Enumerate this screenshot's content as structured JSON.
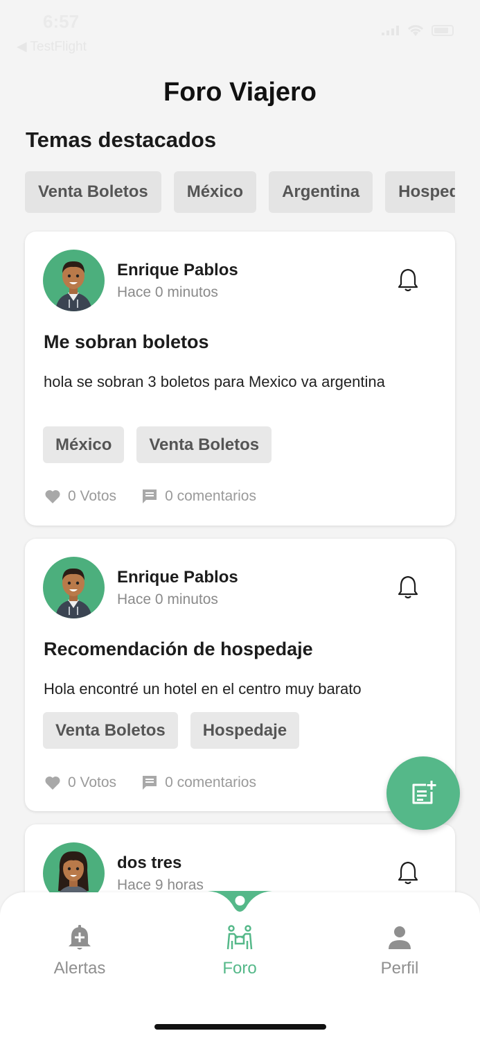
{
  "status_bar": {
    "time": "6:57",
    "back_label": "◀ TestFlight"
  },
  "header": {
    "title": "Foro Viajero"
  },
  "featured": {
    "title": "Temas destacados",
    "topics": [
      "Venta Boletos",
      "México",
      "Argentina",
      "Hospedaje"
    ]
  },
  "posts": [
    {
      "author": "Enrique Pablos",
      "time": "Hace 0 minutos",
      "title": "Me sobran boletos",
      "body": "hola se sobran 3 boletos para Mexico va argentina",
      "tags": [
        "México",
        "Venta Boletos"
      ],
      "votes": "0 Votos",
      "comments": "0 comentarios"
    },
    {
      "author": "Enrique Pablos",
      "time": "Hace 0 minutos",
      "title": "Recomendación de hospedaje",
      "body": "Hola encontré un hotel en el centro muy barato",
      "tags": [
        "Venta Boletos",
        "Hospedaje"
      ],
      "votes": "0 Votos",
      "comments": "0 comentarios"
    },
    {
      "author": "dos tres",
      "time": "Hace 9 horas"
    }
  ],
  "tab_bar": {
    "tabs": [
      {
        "label": "Alertas",
        "icon": "bell-plus-icon"
      },
      {
        "label": "Foro",
        "icon": "people-icon",
        "active": true
      },
      {
        "label": "Perfil",
        "icon": "person-icon"
      }
    ]
  },
  "colors": {
    "accent": "#55b889",
    "avatar_bg": "#4caf7d",
    "chip_bg": "#e4e4e4",
    "muted_text": "#9a9a9a"
  }
}
